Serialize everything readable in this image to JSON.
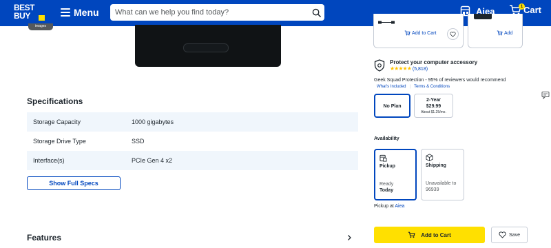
{
  "header": {
    "logo_line1": "BEST",
    "logo_line2": "BUY",
    "menu_label": "Menu",
    "search_placeholder": "What can we help you find today?",
    "store_name": "Aiea",
    "cart_label": "Cart",
    "cart_count": "1"
  },
  "gallery": {
    "label": "images"
  },
  "specifications": {
    "title": "Specifications",
    "rows": [
      {
        "name": "Storage Capacity",
        "value": "1000 gigabytes"
      },
      {
        "name": "Storage Drive Type",
        "value": "SSD"
      },
      {
        "name": "Interface(s)",
        "value": "PCIe Gen 4 x2"
      }
    ],
    "show_full_label": "Show Full Specs"
  },
  "features": {
    "title": "Features"
  },
  "recommendations": {
    "add_to_cart_label": "Add to Cart",
    "add_partial_label": "Add"
  },
  "protection": {
    "title": "Protect your computer accessory",
    "rating": 4.5,
    "review_count": "(5,818)",
    "description": "Geek Squad Protection - 95% of reviewers would recommend",
    "link_whats_included": "What's Included",
    "link_terms": "Terms & Conditions",
    "plans": {
      "none_label": "No Plan",
      "two_year_term": "2-Year",
      "two_year_price": "$29.99",
      "two_year_monthly": "About $1.25/mo."
    }
  },
  "availability": {
    "title": "Availability",
    "pickup": {
      "label": "Pickup",
      "status_line1": "Ready",
      "status_line2": "Today"
    },
    "shipping": {
      "label": "Shipping",
      "status_line1": "Unavailable to",
      "status_line2": "96939"
    },
    "pickup_at_label": "Pickup at",
    "pickup_store": "Aiea"
  },
  "actions": {
    "add_to_cart_label": "Add to Cart",
    "save_label": "Save"
  },
  "colors": {
    "brand_blue": "#0046be",
    "brand_yellow": "#ffe000",
    "text_dark": "#1d252c",
    "spec_shade": "#f0f6fc",
    "border_gray": "#c5cbd5"
  }
}
